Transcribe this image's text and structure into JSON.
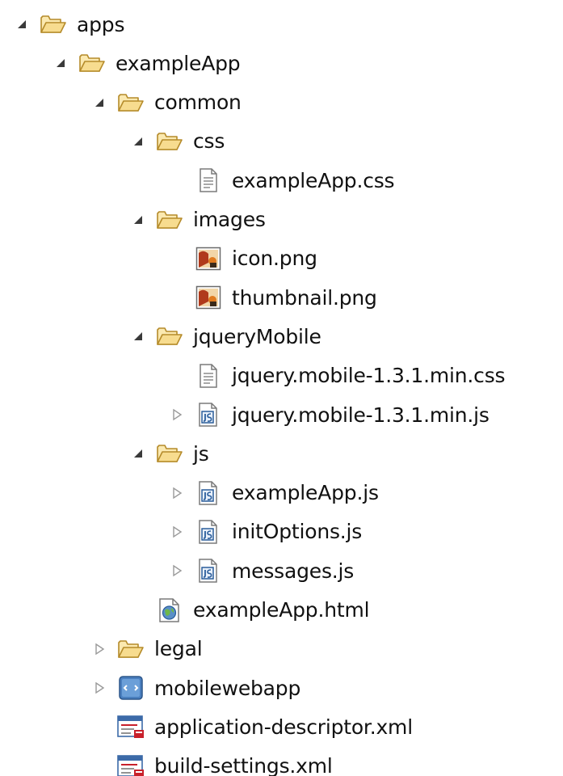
{
  "tree": [
    {
      "label": "apps",
      "icon": "folder-open-icon",
      "state": "expanded",
      "level": 0
    },
    {
      "label": "exampleApp",
      "icon": "folder-open-icon",
      "state": "expanded",
      "level": 1
    },
    {
      "label": "common",
      "icon": "folder-open-icon",
      "state": "expanded",
      "level": 2
    },
    {
      "label": "css",
      "icon": "folder-open-icon",
      "state": "expanded",
      "level": 3
    },
    {
      "label": "exampleApp.css",
      "icon": "text-file-icon",
      "state": "none",
      "level": 4
    },
    {
      "label": "images",
      "icon": "folder-open-icon",
      "state": "expanded",
      "level": 3
    },
    {
      "label": "icon.png",
      "icon": "image-file-icon",
      "state": "none",
      "level": 4
    },
    {
      "label": "thumbnail.png",
      "icon": "image-file-icon",
      "state": "none",
      "level": 4
    },
    {
      "label": "jqueryMobile",
      "icon": "folder-open-icon",
      "state": "expanded",
      "level": 3
    },
    {
      "label": "jquery.mobile-1.3.1.min.css",
      "icon": "text-file-icon",
      "state": "none",
      "level": 4
    },
    {
      "label": "jquery.mobile-1.3.1.min.js",
      "icon": "js-file-icon",
      "state": "collapsed",
      "level": 4
    },
    {
      "label": "js",
      "icon": "folder-open-icon",
      "state": "expanded",
      "level": 3
    },
    {
      "label": "exampleApp.js",
      "icon": "js-file-icon",
      "state": "collapsed",
      "level": 4
    },
    {
      "label": "initOptions.js",
      "icon": "js-file-icon",
      "state": "collapsed",
      "level": 4
    },
    {
      "label": "messages.js",
      "icon": "js-file-icon",
      "state": "collapsed",
      "level": 4
    },
    {
      "label": "exampleApp.html",
      "icon": "html-file-icon",
      "state": "none",
      "level": 3
    },
    {
      "label": "legal",
      "icon": "folder-open-icon",
      "state": "collapsed",
      "level": 2
    },
    {
      "label": "mobilewebapp",
      "icon": "mobile-web-app-icon",
      "state": "collapsed",
      "level": 2
    },
    {
      "label": "application-descriptor.xml",
      "icon": "xml-descriptor-icon",
      "state": "none",
      "level": 2
    },
    {
      "label": "build-settings.xml",
      "icon": "xml-descriptor-icon",
      "state": "none",
      "level": 2
    }
  ],
  "colors": {
    "folder_fill": "#f7dc8f",
    "folder_stroke": "#b58b2a",
    "twisty_expanded": "#3a3a3a",
    "twisty_collapsed": "#9a9a9a",
    "file_blue": "#2a5d9a",
    "image_red": "#b03a1c",
    "xml_red": "#c8202b"
  }
}
